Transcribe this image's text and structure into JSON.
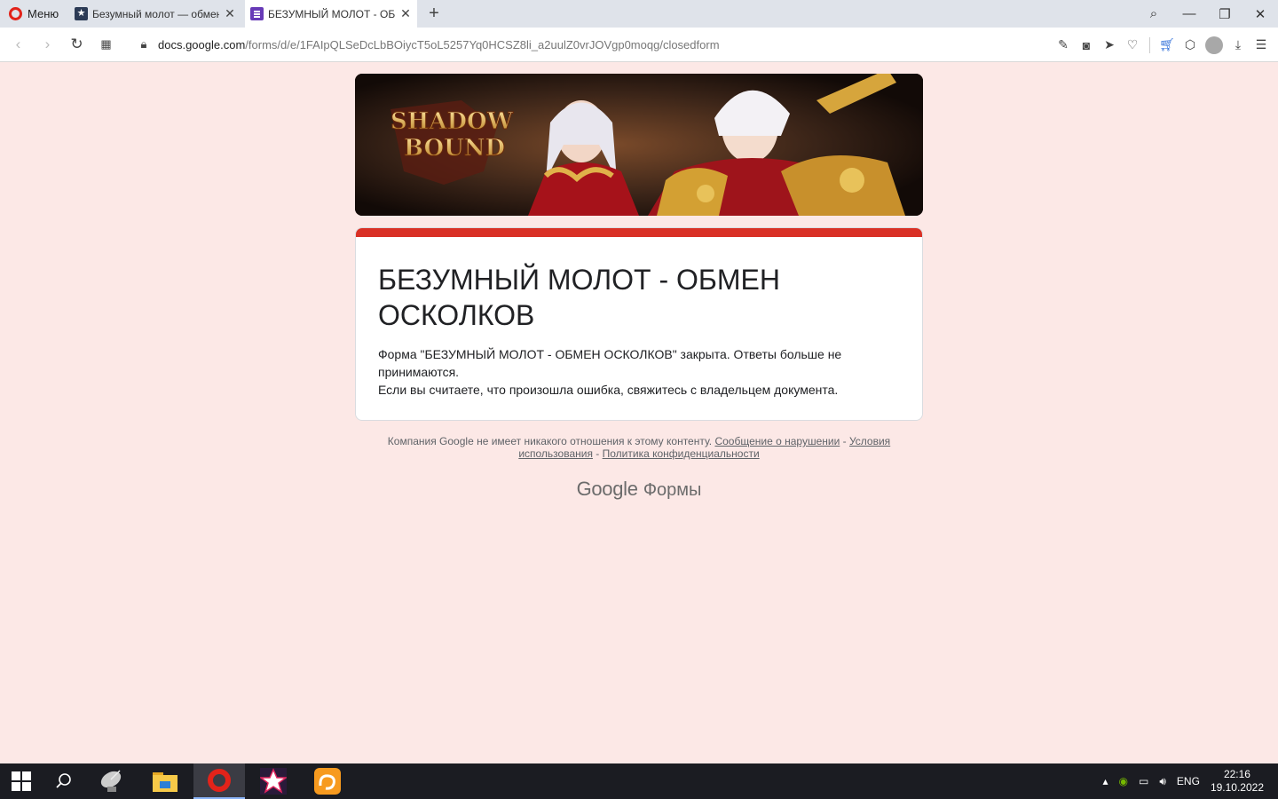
{
  "browser": {
    "menu_label": "Меню",
    "tabs": [
      {
        "title": "Безумный молот — обмен осколков",
        "active": false
      },
      {
        "title": "БЕЗУМНЫЙ МОЛОТ - ОБМЕН ОСКОЛКОВ",
        "active": true
      }
    ],
    "url_host": "docs.google.com",
    "url_path": "/forms/d/e/1FAIpQLSeDcLbBOiycT5oL5257Yq0HCSZ8li_a2uulZ0vrJOVgp0moqg/closedform"
  },
  "form": {
    "title": "БЕЗУМНЫЙ МОЛОТ - ОБМЕН ОСКОЛКОВ",
    "message_line1": "Форма \"БЕЗУМНЫЙ МОЛОТ - ОБМЕН ОСКОЛКОВ\" закрыта. Ответы больше не принимаются.",
    "message_line2": "Если вы считаете, что произошла ошибка, свяжитесь с владельцем документа.",
    "accent_color": "#d93025"
  },
  "footer": {
    "disclaimer": "Компания Google не имеет никакого отношения к этому контенту.",
    "report_link": "Сообщение о нарушении",
    "sep": " - ",
    "terms_link": "Условия использования",
    "privacy_link": "Политика конфиденциальности",
    "brand_google": "Google",
    "brand_forms": "Формы"
  },
  "taskbar": {
    "language": "ENG",
    "time": "22:16",
    "date": "19.10.2022"
  }
}
